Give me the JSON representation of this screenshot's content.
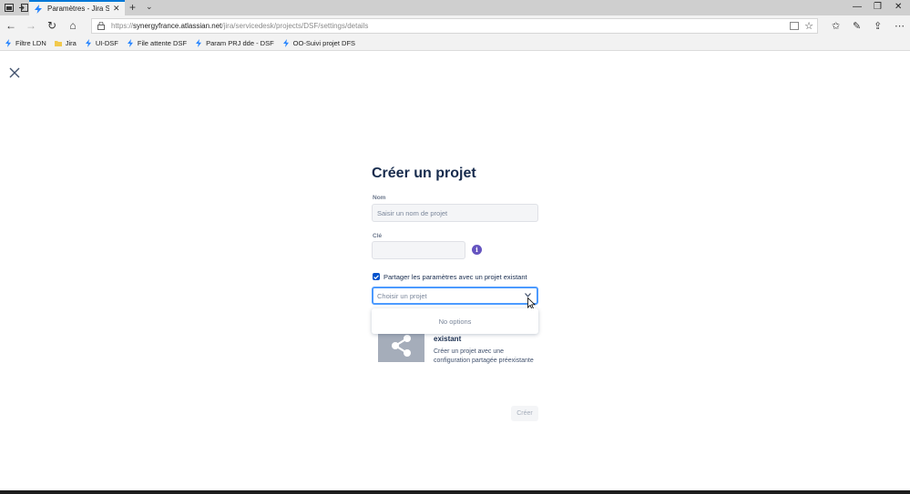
{
  "browser": {
    "tab_title": "Paramètres - Jira Servic",
    "url_prefix": "https://",
    "url_host": "synergyfrance.atlassian.net",
    "url_path": "/jira/servicedesk/projects/DSF/settings/details",
    "bookmarks": [
      {
        "label": "Filtre LDN",
        "icon": "jira-bolt-icon"
      },
      {
        "label": "Jira",
        "icon": "folder-icon"
      },
      {
        "label": "UI-DSF",
        "icon": "jira-bolt-icon"
      },
      {
        "label": "File attente DSF",
        "icon": "jira-bolt-icon"
      },
      {
        "label": "Param PRJ dde - DSF",
        "icon": "jira-bolt-icon"
      },
      {
        "label": "OO-Suivi projet DFS",
        "icon": "jira-bolt-icon"
      }
    ],
    "accent_color": "#0078d7"
  },
  "form": {
    "title": "Créer un projet",
    "name_label": "Nom",
    "name_placeholder": "Saisir un nom de projet",
    "key_label": "Clé",
    "key_value": "",
    "share_checked": true,
    "share_label": "Partager les paramètres avec un projet existant",
    "select_placeholder": "Choisir un projet",
    "dropdown_empty": "No options",
    "card_title": "existant",
    "card_description": "Créer un projet avec une configuration partagée préexistante",
    "create_button": "Créer"
  },
  "colors": {
    "primary": "#0052cc",
    "focus_border": "#4c9aff",
    "info": "#6554c0"
  }
}
